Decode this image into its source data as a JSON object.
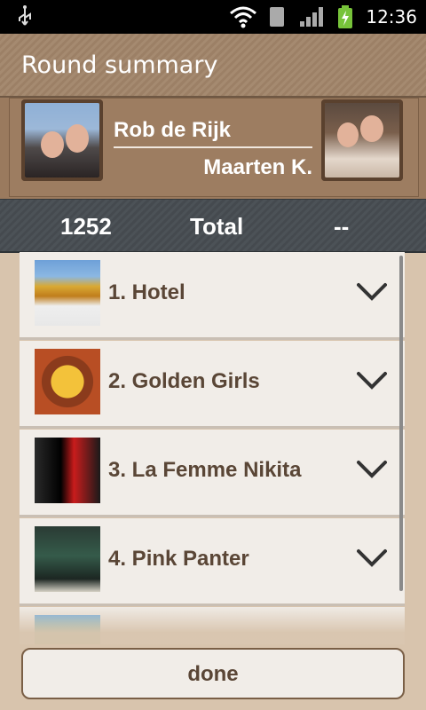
{
  "status": {
    "time": "12:36",
    "icons": [
      "usb-icon",
      "wifi-icon",
      "sim-icon",
      "signal-icon",
      "battery-icon"
    ]
  },
  "header": {
    "title": "Round summary"
  },
  "players": {
    "player1": "Rob de Rijk",
    "player2": "Maarten K."
  },
  "score": {
    "left": "1252",
    "label": "Total",
    "right": "--"
  },
  "songs": [
    {
      "label": "1. Hotel"
    },
    {
      "label": "2. Golden Girls"
    },
    {
      "label": "3. La Femme Nikita"
    },
    {
      "label": "4. Pink Panter"
    },
    {
      "label": ""
    }
  ],
  "footer": {
    "done_label": "done"
  },
  "colors": {
    "accent": "#9d7d61",
    "text_brown": "#5a4636",
    "bar_dark": "#4c5257"
  }
}
